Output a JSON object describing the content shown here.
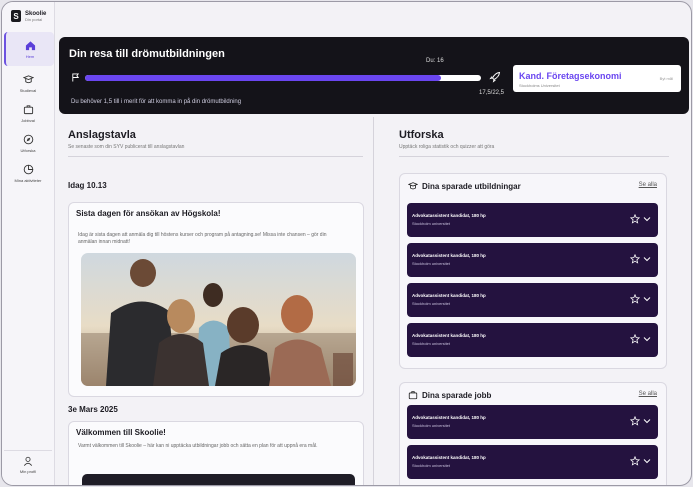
{
  "app": {
    "name": "Skoolie",
    "tagline": "Din portal"
  },
  "sidebar": {
    "items": [
      {
        "label": "Hem",
        "icon": "home-icon"
      },
      {
        "label": "Studieval",
        "icon": "graduation-cap-icon"
      },
      {
        "label": "Jobbval",
        "icon": "briefcase-icon"
      },
      {
        "label": "Utforska",
        "icon": "compass-icon"
      },
      {
        "label": "Mina aktiviteter",
        "icon": "activity-icon"
      }
    ],
    "profile_label": "Min profil"
  },
  "hero": {
    "title": "Din resa till drömutbildningen",
    "marker_label": "Du: 16",
    "score_label": "17,5/22,5",
    "progress_fraction": 0.9,
    "subtitle": "Du behöver 1,5 till i merit för att komma in på din drömutbildning",
    "goal_title": "Kand. Företagsekonomi",
    "goal_school": "Stockholms Universitet",
    "goal_action": "Byt mål"
  },
  "board": {
    "title": "Anslagstavla",
    "subtitle": "Se senaste som din SYV publicerat till anslagstavlan",
    "posts": [
      {
        "date": "Idag 10.13",
        "title": "Sista dagen för ansökan av Högskola!",
        "body": "Idag är sista dagen att anmäla dig till höstens kurser och program på antagning.se! Missa inte chansen – gör din anmälan innan midnatt!"
      },
      {
        "date": "3e Mars 2025",
        "title": "Välkommen till Skoolie!",
        "body": "Varmt välkommen till Skoolie – här kan ni upptäcka utbildningar jobb och sätta en plan för att uppnå era mål."
      }
    ]
  },
  "explore": {
    "title": "Utforska",
    "subtitle": "Upptäck roliga statistik och quizzer att göra",
    "saved_programs": {
      "title": "Dina sparade utbildningar",
      "see_all": "Se alla",
      "items": [
        {
          "name": "Advokatassistent kandidat, 180 hp",
          "school": "Stockholm universitet"
        },
        {
          "name": "Advokatassistent kandidat, 180 hp",
          "school": "Stockholm universitet"
        },
        {
          "name": "Advokatassistent kandidat, 180 hp",
          "school": "Stockholm universitet"
        },
        {
          "name": "Advokatassistent kandidat, 180 hp",
          "school": "Stockholm universitet"
        }
      ]
    },
    "saved_jobs": {
      "title": "Dina sparade jobb",
      "see_all": "Se alla",
      "items": [
        {
          "name": "Advokatassistent kandidat, 180 hp",
          "school": "Stockholm universitet"
        },
        {
          "name": "Advokatassistent kandidat, 180 hp",
          "school": "Stockholm universitet"
        }
      ]
    }
  },
  "colors": {
    "accent": "#6a46f0",
    "hero_bg": "#141319",
    "item_bg": "#24123f"
  }
}
